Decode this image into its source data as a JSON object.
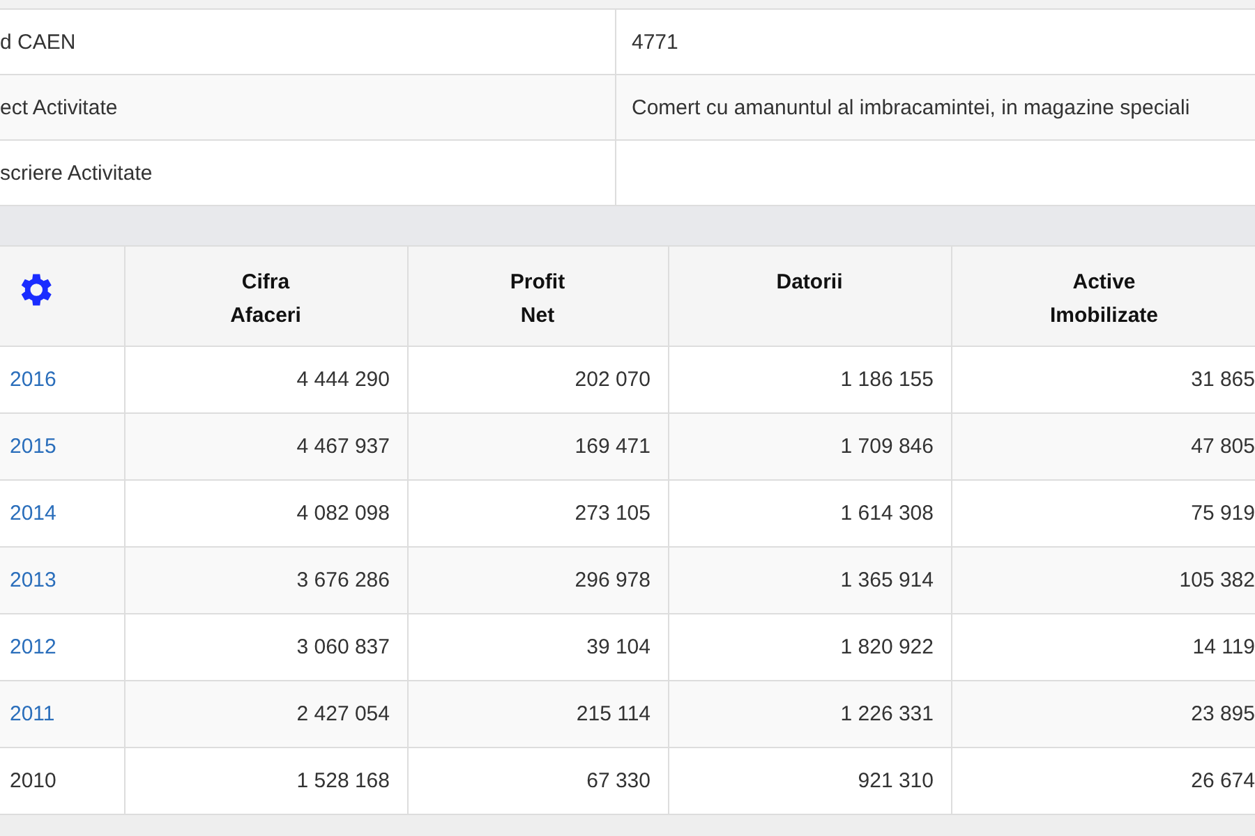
{
  "info_table": [
    {
      "label": "d CAEN",
      "value": "4771"
    },
    {
      "label": "ect Activitate",
      "value": "Comert cu amanuntul al imbracamintei, in magazine speciali"
    },
    {
      "label": "scriere Activitate"
    }
  ],
  "financial_table": {
    "columns": [
      "Cifra\nAfaceri",
      "Profit\nNet",
      "Datorii",
      "Active\nImobilizate"
    ],
    "rows": [
      {
        "year": "2016",
        "link": true,
        "values": [
          "4 444 290",
          "202 070",
          "1 186 155",
          "31 865"
        ]
      },
      {
        "year": "2015",
        "link": true,
        "values": [
          "4 467 937",
          "169 471",
          "1 709 846",
          "47 805"
        ]
      },
      {
        "year": "2014",
        "link": true,
        "values": [
          "4 082 098",
          "273 105",
          "1 614 308",
          "75 919"
        ]
      },
      {
        "year": "2013",
        "link": true,
        "values": [
          "3 676 286",
          "296 978",
          "1 365 914",
          "105 382"
        ]
      },
      {
        "year": "2012",
        "link": true,
        "values": [
          "3 060 837",
          "39 104",
          "1 820 922",
          "14 119"
        ]
      },
      {
        "year": "2011",
        "link": true,
        "values": [
          "2 427 054",
          "215 114",
          "1 226 331",
          "23 895"
        ]
      },
      {
        "year": "2010",
        "link": false,
        "values": [
          "1 528 168",
          "67 330",
          "921 310",
          "26 674"
        ]
      }
    ]
  }
}
